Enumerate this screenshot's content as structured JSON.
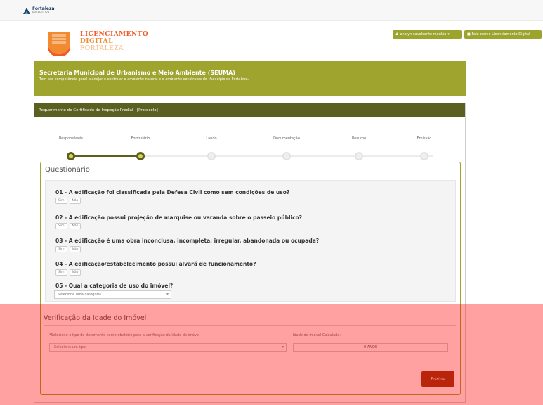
{
  "topbar": {
    "logo_name": "Fortaleza",
    "logo_sub": "PREFEITURA"
  },
  "brand": {
    "line1": "LICENCIAMENTO",
    "line2": "DIGITAL",
    "line3": "FORTALEZA"
  },
  "header_buttons": {
    "user": "analyn cavalcante moulão",
    "talk": "Fale com o Licenciamento Digital"
  },
  "banner": {
    "title": "Secretaria Municipal de Urbanismo e Meio Ambiente (SEUMA)",
    "subtitle": "Tem por competência geral planejar e controlar o ambiente natural e o ambiente construído do Município de Fortaleza."
  },
  "panel": {
    "title": "Requerimento de Certificado de Inspeção Predial - [Protocolo]"
  },
  "steps": [
    {
      "label": "Responsáveis",
      "state": "done"
    },
    {
      "label": "Formulário",
      "state": "done"
    },
    {
      "label": "Laudo",
      "state": "todo"
    },
    {
      "label": "Documentação",
      "state": "todo"
    },
    {
      "label": "Resumo",
      "state": "todo"
    },
    {
      "label": "Emissão",
      "state": "todo"
    }
  ],
  "questionnaire": {
    "title": "Questionário",
    "yes": "Sim",
    "no": "Não",
    "questions": [
      "01 - A edificação foi classificada pela Defesa Civil como sem condições de uso?",
      "02 - A edificação possui projeção de marquise ou varanda sobre o passeio público?",
      "03 - A edificação é uma obra inconclusa, incompleta, irregular, abandonada ou ocupada?",
      "04 - A edificação/estabelecimento possui alvará de funcionamento?",
      "05 - Qual a categoria de uso do imóvel?"
    ],
    "category_placeholder": "Selecione uma categoria"
  },
  "verification": {
    "title": "Verificação da Idade do Imóvel",
    "doc_label": "*Selecione o tipo de documento comprobatório para a verificação da idade do imóvel",
    "age_label": "Idade do imóvel Calculada:",
    "doc_placeholder": "Selecione um tipo",
    "age_value": "0 ANOS"
  },
  "actions": {
    "next": "Próximo"
  },
  "colors": {
    "olive": "#9fa42f",
    "dark_olive": "#5b6021",
    "brand_orange": "#f05a28",
    "next_button": "#8f3b11",
    "overlay": "#ff0000"
  }
}
